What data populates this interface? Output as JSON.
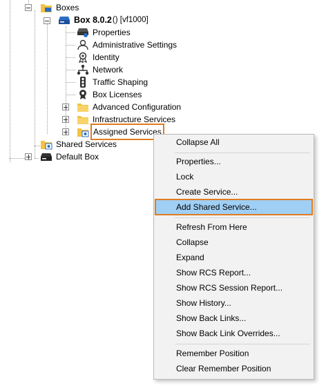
{
  "tree": {
    "boxes": "Boxes",
    "box_name": "Box 8.0.2",
    "box_suffix": "() [vf1000]",
    "items": [
      {
        "label": "Properties"
      },
      {
        "label": "Administrative Settings"
      },
      {
        "label": "Identity"
      },
      {
        "label": "Network"
      },
      {
        "label": "Traffic Shaping"
      },
      {
        "label": "Box Licenses"
      },
      {
        "label": "Advanced Configuration"
      },
      {
        "label": "Infrastructure Services"
      },
      {
        "label": "Assigned Services"
      }
    ],
    "shared_services": "Shared Services",
    "default_box": "Default Box"
  },
  "context_menu": {
    "items": [
      "Collapse All",
      "Properties...",
      "Lock",
      "Create Service...",
      "Add Shared Service...",
      "Refresh From Here",
      "Collapse",
      "Expand",
      "Show RCS Report...",
      "Show RCS Session Report...",
      "Show History...",
      "Show Back Links...",
      "Show Back Link Overrides...",
      "Remember Position",
      "Clear Remember Position"
    ]
  },
  "colors": {
    "highlight_border": "#e07b1f",
    "menu_selection": "#9fcff5",
    "folder_yellow": "#f5c242"
  }
}
